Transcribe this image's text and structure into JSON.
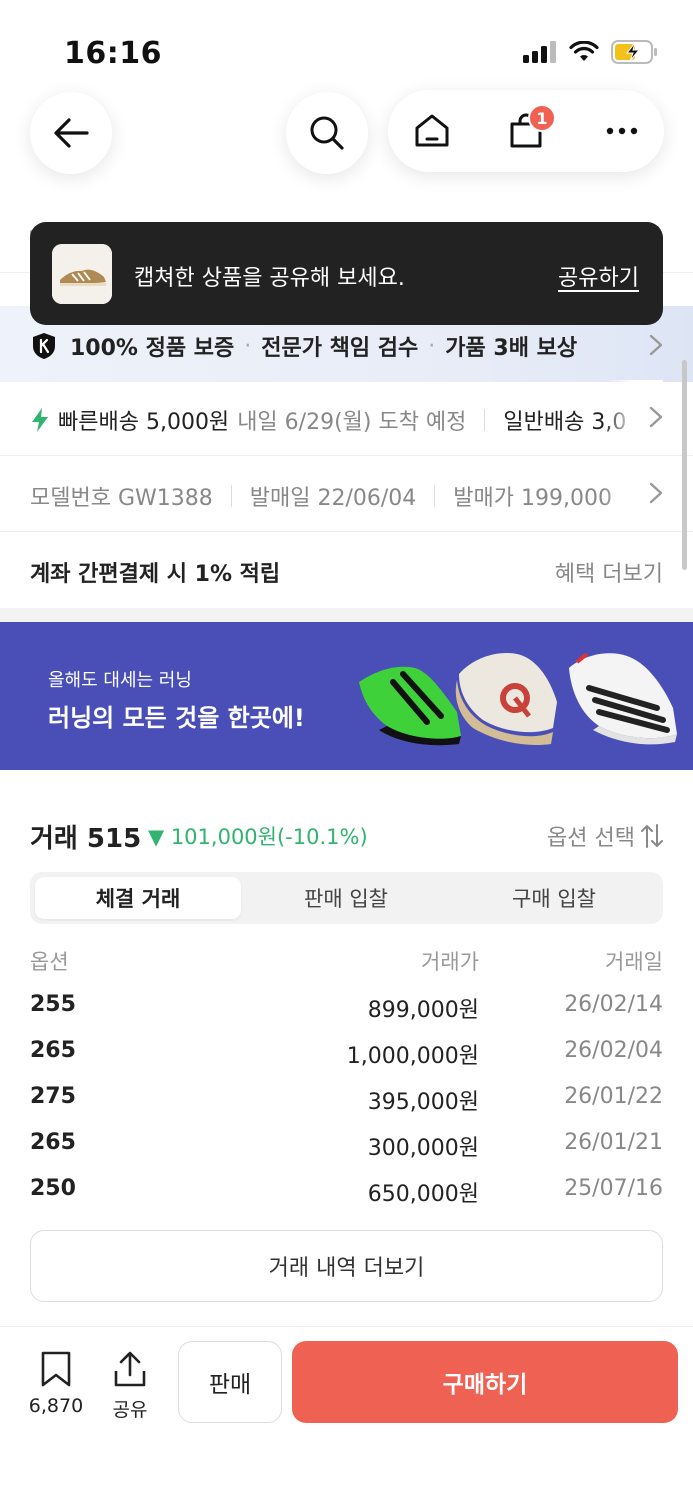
{
  "status": {
    "time": "16:16"
  },
  "toast": {
    "message": "캡쳐한 상품을 공유해 보세요.",
    "action": "공유하기"
  },
  "header": {
    "cart_count": "1"
  },
  "guarantee": {
    "items": [
      "100% 정품 보증",
      "전문가 책임 검수",
      "가품 3배 보상"
    ]
  },
  "shipping": {
    "fast_label": "빠른배송 5,000원",
    "fast_eta": "내일 6/29(월) 도착 예정",
    "normal_label": "일반배송 3,0"
  },
  "product_info": {
    "model": "모델번호 GW1388",
    "release_date": "발매일 22/06/04",
    "release_price": "발매가 199,000"
  },
  "benefit": {
    "label": "계좌 간편결제 시 1% 적립",
    "more": "혜택 더보기"
  },
  "banner": {
    "subtitle": "올해도 대세는 러닝",
    "title": "러닝의 모든 것을 한곳에!"
  },
  "trade": {
    "title": "거래 515",
    "change": "▼ 101,000원(-10.1%)",
    "option_select": "옵션 선택",
    "tabs": [
      "체결 거래",
      "판매 입찰",
      "구매 입찰"
    ],
    "columns": [
      "옵션",
      "거래가",
      "거래일"
    ],
    "rows": [
      {
        "option": "255",
        "price": "899,000원",
        "date": "26/02/14"
      },
      {
        "option": "265",
        "price": "1,000,000원",
        "date": "26/02/04"
      },
      {
        "option": "275",
        "price": "395,000원",
        "date": "26/01/22"
      },
      {
        "option": "265",
        "price": "300,000원",
        "date": "26/01/21"
      },
      {
        "option": "250",
        "price": "650,000원",
        "date": "25/07/16"
      }
    ],
    "more_button": "거래 내역 더보기"
  },
  "bottom_bar": {
    "bookmark_count": "6,870",
    "share_label": "공유",
    "sell_label": "판매",
    "buy_label": "구매하기"
  },
  "colors": {
    "accent": "#ef6253",
    "down": "#31b46e",
    "banner": "#4a4fb8"
  }
}
